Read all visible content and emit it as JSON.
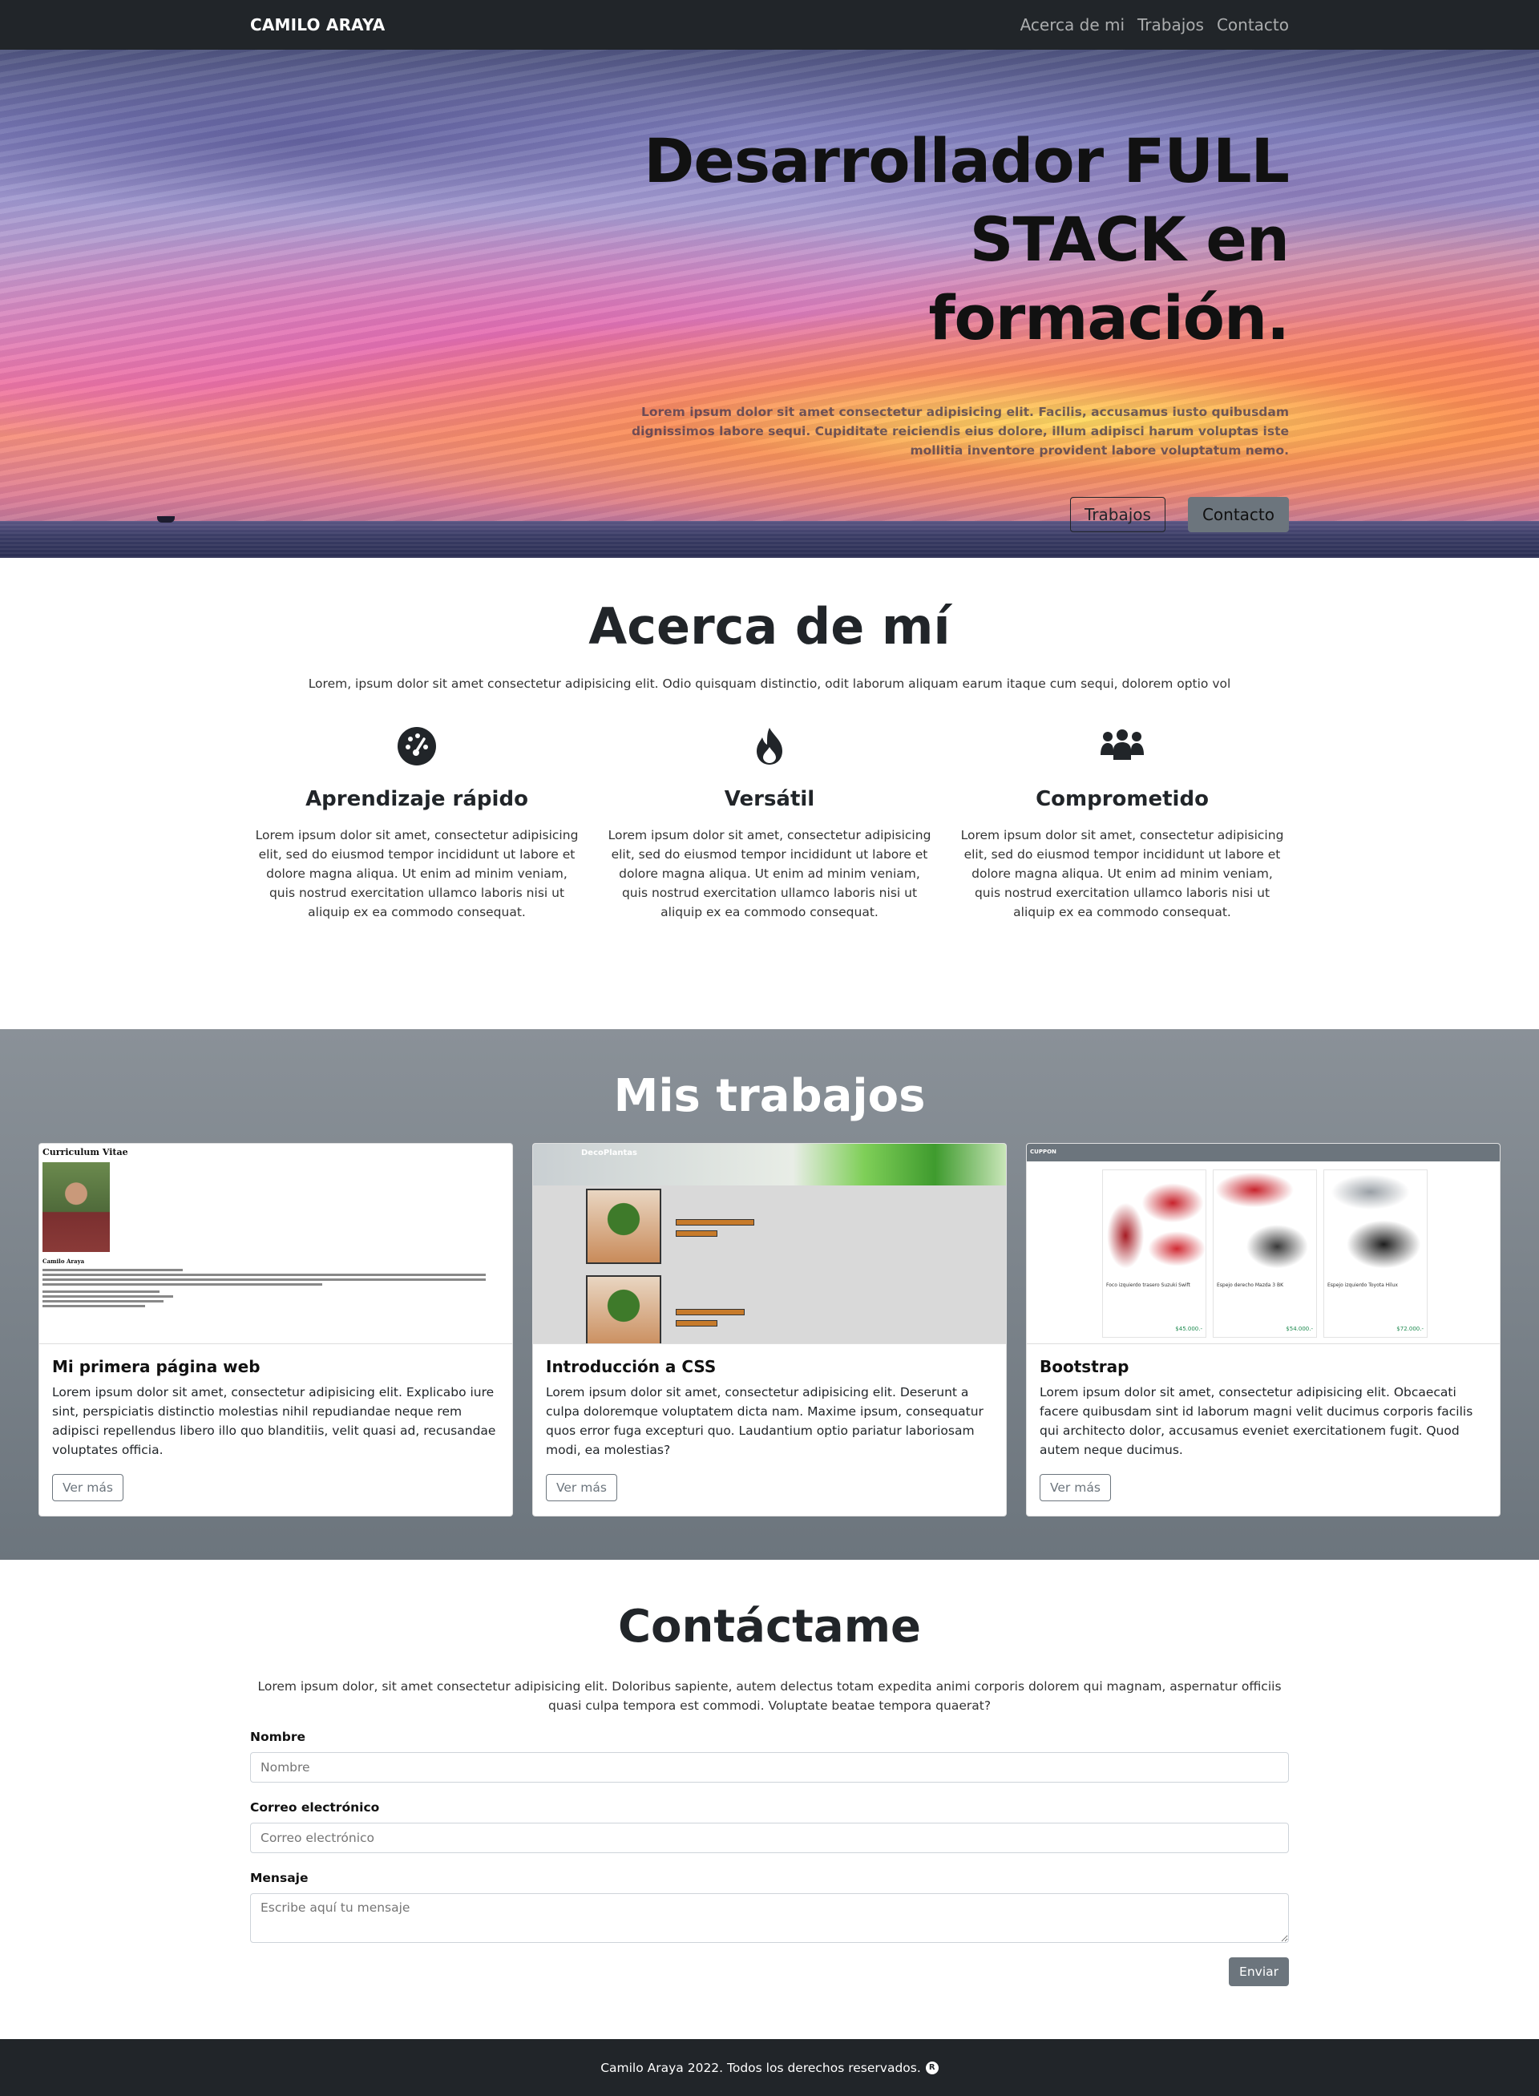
{
  "navbar": {
    "brand": "CAMILO ARAYA",
    "links": [
      "Acerca de mi",
      "Trabajos",
      "Contacto"
    ]
  },
  "hero": {
    "title_line1": "Desarrollador FULL",
    "title_line2": "STACK en formación.",
    "text": "Lorem ipsum dolor sit amet consectetur adipisicing elit. Facilis, accusamus iusto quibusdam dignissimos labore sequi. Cupiditate reiciendis eius dolore, illum adipisci harum voluptas iste mollitia inventore provident labore voluptatum nemo.",
    "buttons": {
      "primary": "Trabajos",
      "secondary": "Contacto"
    }
  },
  "about": {
    "title": "Acerca de mí",
    "lead": "Lorem, ipsum dolor sit amet consectetur adipisicing elit. Odio quisquam distinctio, odit laborum aliquam earum itaque cum sequi, dolorem optio vol",
    "features": [
      {
        "icon": "speedometer-icon",
        "title": "Aprendizaje rápido",
        "text": "Lorem ipsum dolor sit amet, consectetur adipisicing elit, sed do eiusmod tempor incididunt ut labore et dolore magna aliqua. Ut enim ad minim veniam, quis nostrud exercitation ullamco laboris nisi ut aliquip ex ea commodo consequat."
      },
      {
        "icon": "fire-icon",
        "title": "Versátil",
        "text": "Lorem ipsum dolor sit amet, consectetur adipisicing elit, sed do eiusmod tempor incididunt ut labore et dolore magna aliqua. Ut enim ad minim veniam, quis nostrud exercitation ullamco laboris nisi ut aliquip ex ea commodo consequat."
      },
      {
        "icon": "people-icon",
        "title": "Comprometido",
        "text": "Lorem ipsum dolor sit amet, consectetur adipisicing elit, sed do eiusmod tempor incididunt ut labore et dolore magna aliqua. Ut enim ad minim veniam, quis nostrud exercitation ullamco laboris nisi ut aliquip ex ea commodo consequat."
      }
    ]
  },
  "works": {
    "title": "Mis trabajos",
    "cards": [
      {
        "title": "Mi primera página web",
        "text": "Lorem ipsum dolor sit amet, consectetur adipisicing elit. Explicabo iure sint, perspiciatis distinctio molestias nihil repudiandae neque rem adipisci repellendus libero illo quo blanditiis, velit quasi ad, recusandae voluptates officia.",
        "button": "Ver más",
        "thumb": {
          "heading": "Curriculum Vitae",
          "name": "Camilo Araya"
        }
      },
      {
        "title": "Introducción a CSS",
        "text": "Lorem ipsum dolor sit amet, consectetur adipisicing elit. Deserunt a culpa doloremque voluptatem dicta nam. Maxime ipsum, consequatur quos error fuga excepturi quo. Laudantium optio pariatur laboriosam modi, ea molestias?",
        "button": "Ver más",
        "thumb": {
          "heading": "DecoPlantas"
        }
      },
      {
        "title": "Bootstrap",
        "text": "Lorem ipsum dolor sit amet, consectetur adipisicing elit. Obcaecati facere quibusdam sint id laborum magni velit ducimus corporis facilis qui architecto dolor, accusamus eveniet exercitationem fugit. Quod autem neque ducimus.",
        "button": "Ver más",
        "thumb": {
          "heading": "CUPPON",
          "items": [
            {
              "name": "Foco izquierdo trasero Suzuki Swift",
              "price": "$45.000.-"
            },
            {
              "name": "Espejo derecho Mazda 3 BK",
              "price": "$54.000.-"
            },
            {
              "name": "Espejo izquierdo Toyota Hilux",
              "price": "$72.000.-"
            }
          ]
        }
      }
    ]
  },
  "contact": {
    "title": "Contáctame",
    "lead": "Lorem ipsum dolor, sit amet consectetur adipisicing elit. Doloribus sapiente, autem delectus totam expedita animi corporis dolorem qui magnam, aspernatur officiis quasi culpa tempora est commodi. Voluptate beatae tempora quaerat?",
    "fields": {
      "name_label": "Nombre",
      "name_placeholder": "Nombre",
      "email_label": "Correo electrónico",
      "email_placeholder": "Correo electrónico",
      "message_label": "Mensaje",
      "message_placeholder": "Escribe aquí tu mensaje"
    },
    "submit": "Enviar"
  },
  "footer": {
    "text": "Camilo Araya 2022. Todos los derechos reservados.",
    "icon": "registered-icon",
    "icon_glyph": "R"
  },
  "colors": {
    "navbar": "#212529",
    "secondary": "#6c757d",
    "footer": "#212529"
  }
}
